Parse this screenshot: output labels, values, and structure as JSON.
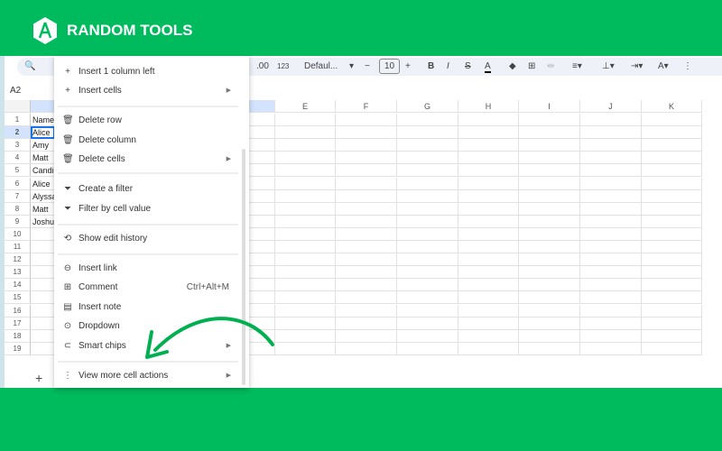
{
  "brand": {
    "name": "RANDOM TOOLS"
  },
  "toolbar": {
    "decimal": ".00",
    "format": "123",
    "font": "Defaul...",
    "font_size": "10",
    "bold": "B",
    "italic": "I",
    "strike": "S",
    "text_color": "A"
  },
  "namebox": "A2",
  "columns": [
    "E",
    "F",
    "G",
    "H",
    "I",
    "J",
    "K"
  ],
  "rows": [
    {
      "n": "1",
      "a": "Name"
    },
    {
      "n": "2",
      "a": "Alice"
    },
    {
      "n": "3",
      "a": "Amy"
    },
    {
      "n": "4",
      "a": "Matt"
    },
    {
      "n": "5",
      "a": "Candic"
    },
    {
      "n": "6",
      "a": "Alice"
    },
    {
      "n": "7",
      "a": "Alyssa"
    },
    {
      "n": "8",
      "a": "Matt"
    },
    {
      "n": "9",
      "a": "Joshua"
    },
    {
      "n": "10",
      "a": ""
    },
    {
      "n": "11",
      "a": ""
    },
    {
      "n": "12",
      "a": ""
    },
    {
      "n": "13",
      "a": ""
    },
    {
      "n": "14",
      "a": ""
    },
    {
      "n": "15",
      "a": ""
    },
    {
      "n": "16",
      "a": ""
    },
    {
      "n": "17",
      "a": ""
    },
    {
      "n": "18",
      "a": ""
    },
    {
      "n": "19",
      "a": ""
    }
  ],
  "menu": [
    {
      "label": "Insert 1 column left",
      "icon": "+"
    },
    {
      "label": "Insert cells",
      "icon": "+",
      "submenu": true
    },
    {
      "label": "Delete row",
      "icon": "🗑"
    },
    {
      "label": "Delete column",
      "icon": "🗑"
    },
    {
      "label": "Delete cells",
      "icon": "🗑",
      "submenu": true
    },
    {
      "label": "Create a filter",
      "icon": "⏷"
    },
    {
      "label": "Filter by cell value",
      "icon": "⏷"
    },
    {
      "label": "Show edit history",
      "icon": "⟲"
    },
    {
      "label": "Insert link",
      "icon": "⊖"
    },
    {
      "label": "Comment",
      "icon": "⊞",
      "shortcut": "Ctrl+Alt+M"
    },
    {
      "label": "Insert note",
      "icon": "▤"
    },
    {
      "label": "Dropdown",
      "icon": "⊙"
    },
    {
      "label": "Smart chips",
      "icon": "⊂",
      "submenu": true
    },
    {
      "label": "View more cell actions",
      "icon": "⋮",
      "submenu": true
    }
  ],
  "add_sheet": "+",
  "accent": "#00bb5e"
}
